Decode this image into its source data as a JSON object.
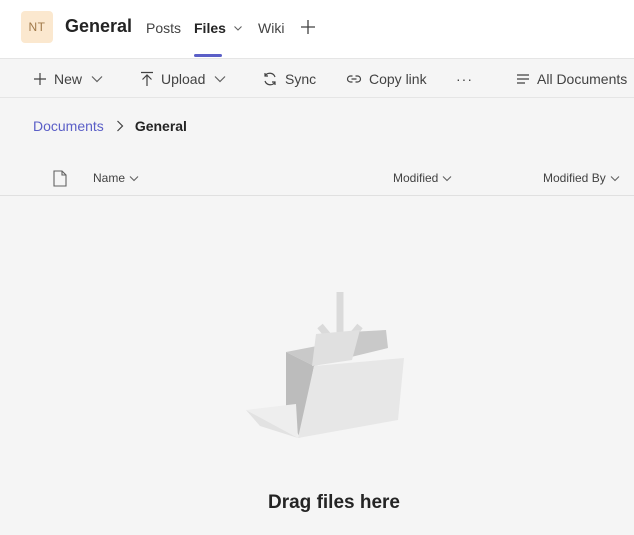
{
  "header": {
    "avatar_initials": "NT",
    "channel_name": "General",
    "tabs": [
      {
        "label": "Posts"
      },
      {
        "label": "Files"
      },
      {
        "label": "Wiki"
      }
    ],
    "add_tab_icon": "plus-icon"
  },
  "toolbar": {
    "new_label": "New",
    "upload_label": "Upload",
    "sync_label": "Sync",
    "copy_link_label": "Copy link",
    "more_label": "···",
    "view_label": "All Documents"
  },
  "breadcrumb": {
    "root": "Documents",
    "current": "General"
  },
  "columns": {
    "name": "Name",
    "modified": "Modified",
    "modified_by": "Modified By"
  },
  "empty_state": {
    "label": "Drag files here",
    "illustration": "folder-with-arrow"
  },
  "colors": {
    "accent": "#5b5fc7",
    "avatar_bg": "#fbe8cf",
    "avatar_text": "#a17a4a"
  }
}
